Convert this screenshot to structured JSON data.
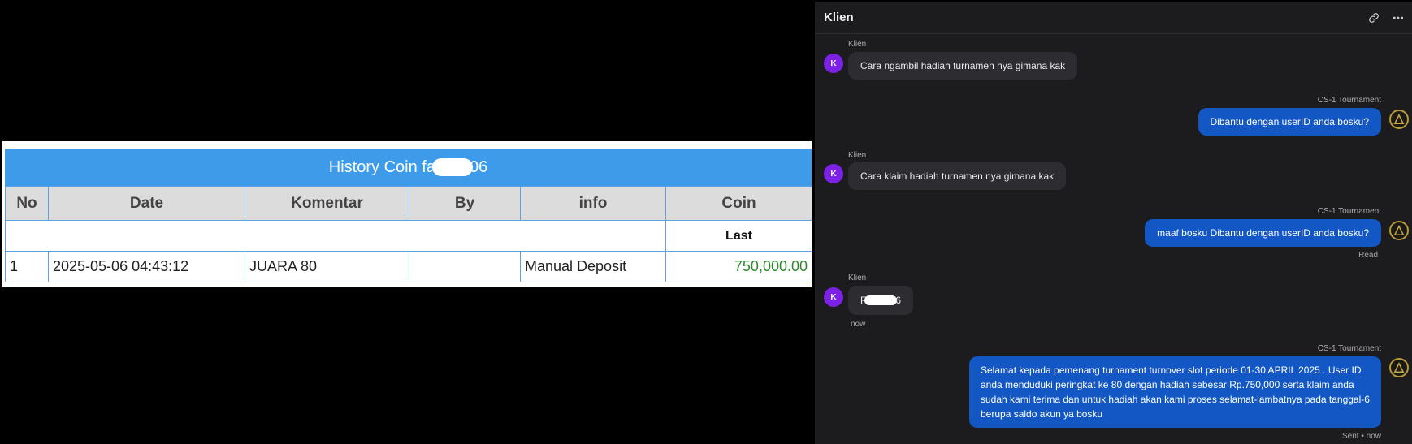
{
  "history": {
    "title_prefix": "History Coin fa",
    "title_suffix": "06",
    "columns": [
      "No",
      "Date",
      "Komentar",
      "By",
      "info",
      "Coin"
    ],
    "subheader_last": "Last",
    "rows": [
      {
        "no": "1",
        "date": "2025-05-06 04:43:12",
        "komentar": "JUARA 80",
        "by": "",
        "info": "Manual Deposit",
        "coin": "750,000.00"
      }
    ]
  },
  "chat": {
    "title": "Klien",
    "icons": {
      "link": "link-icon",
      "more": "more-horizontal-icon"
    },
    "messages": [
      {
        "sender": "Klien",
        "avatar": "K",
        "text": "Cara ngambil hadiah turnamen nya gimana kak"
      },
      {
        "sender": "CS-1 Tournament",
        "text": "Dibantu dengan userID anda bosku?"
      },
      {
        "sender": "Klien",
        "avatar": "K",
        "text": "Cara klaim hadiah turnamen nya gimana kak"
      },
      {
        "sender": "CS-1 Tournament",
        "text": "maaf bosku Dibantu dengan userID anda bosku?",
        "status": "Read"
      },
      {
        "sender": "Klien",
        "avatar": "K",
        "text_prefix": "F",
        "text_suffix": "6",
        "time": "now"
      },
      {
        "sender": "CS-1 Tournament",
        "text": "Selamat kepada pemenang turnament turnover slot periode 01-30 APRIL 2025 . User ID anda menduduki peringkat ke 80 dengan hadiah sebesar Rp.750,000 serta klaim anda sudah kami terima dan untuk hadiah akan kami proses selamat-lambatnya pada tanggal-6 berupa saldo akun ya bosku",
        "status": "Sent • now"
      }
    ]
  },
  "colors": {
    "table_header_blue": "#3d9be9",
    "coin_green": "#2b8a2b",
    "bubble_out": "#1357c4",
    "bubble_in": "#2c2c31",
    "avatar_purple": "#7c22e6"
  }
}
